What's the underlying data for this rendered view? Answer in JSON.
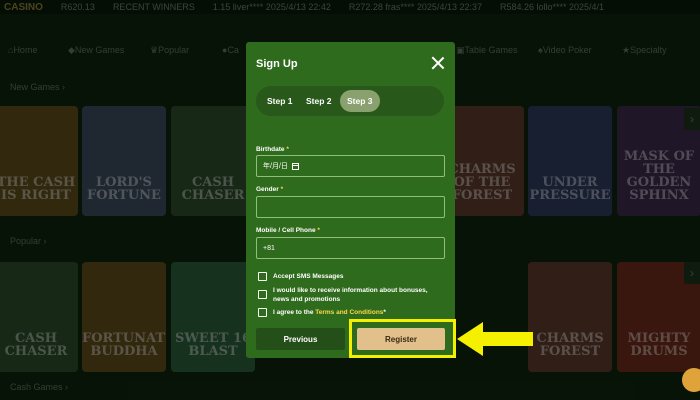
{
  "ticker": {
    "logo": "CASINO",
    "balance": "R620.13",
    "recent_winners_label": "RECENT WINNERS",
    "winner1": "1.15 liver**** 2025/4/13 22:42",
    "winner2": "R272.28 fras**** 2025/4/13 22:37",
    "winner3": "R584.26 lollo**** 2025/4/1"
  },
  "nav": {
    "items": [
      "Home",
      "New Games",
      "Popular",
      "Ca",
      "Table Games",
      "Video Poker",
      "Specialty"
    ]
  },
  "sections": {
    "new_games": "New Games",
    "popular": "Popular",
    "cash_games": "Cash Games"
  },
  "tiles_row1": [
    "THE CASH IS RIGHT",
    "LORD'S FORTUNE",
    "CASH CHASER",
    "",
    "",
    "",
    "CHARMS OF THE FOREST",
    "UNDER PRESSURE",
    "MASK OF THE GOLDEN SPHINX"
  ],
  "tiles_row2": [
    "CASH CHASER",
    "FORTUNATE BUDDHA",
    "SWEET 16 BLAST",
    "",
    "",
    "",
    "",
    "CHARMS FOREST",
    "MIGHTY DRUMS"
  ],
  "modal": {
    "title": "Sign Up",
    "steps": [
      "Step 1",
      "Step 2",
      "Step 3"
    ],
    "active_step": 2,
    "birthdate_label": "Birthdate",
    "birthdate_value": "年/月/日",
    "gender_label": "Gender",
    "gender_value": "",
    "phone_label": "Mobile / Cell Phone",
    "phone_value": "+81",
    "required_mark": "*",
    "sms_label": "Accept SMS Messages",
    "promo_label": "I would like to receive information about bonuses, news and promotions",
    "terms_prefix": "I agree to the ",
    "terms_link": "Terms and Conditions",
    "previous_label": "Previous",
    "register_label": "Register"
  },
  "colors": {
    "modal_bg": "#2f6b1c",
    "register_bg": "#e2c08c",
    "highlight": "#f5f000",
    "required": "#ffd84a"
  }
}
